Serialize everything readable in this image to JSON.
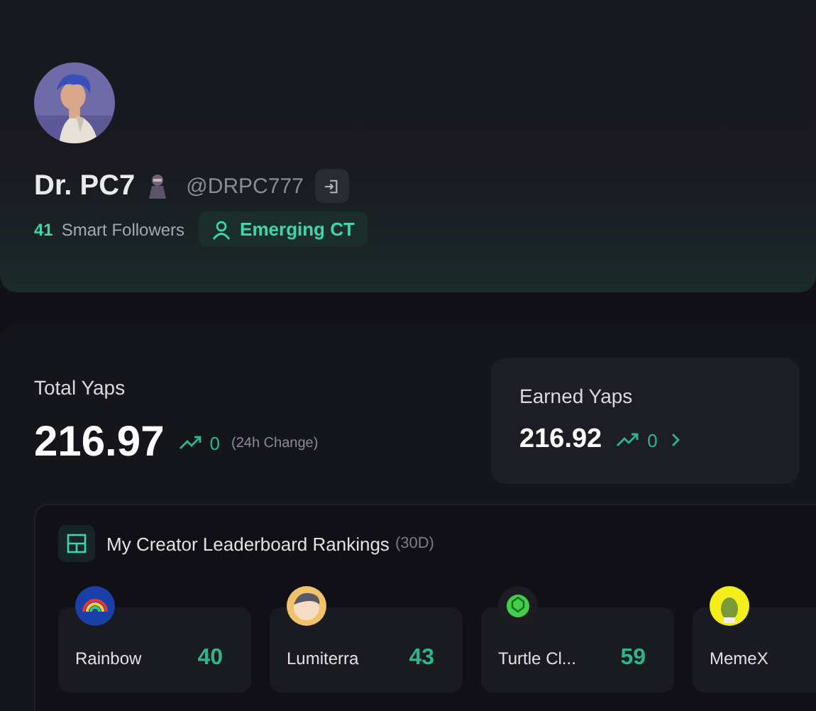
{
  "profile": {
    "name": "Dr. PC7",
    "handle": "@DRPC777",
    "smart_followers": {
      "count": "41",
      "label": "Smart Followers"
    },
    "tag": "Emerging CT"
  },
  "total": {
    "label": "Total Yaps",
    "value": "216.97",
    "change": "0",
    "note": "(24h Change)"
  },
  "earned": {
    "label": "Earned Yaps",
    "value": "216.92",
    "change": "0"
  },
  "leaderboard": {
    "title": "My Creator Leaderboard Rankings",
    "period": "(30D)",
    "items": [
      {
        "name": "Rainbow",
        "rank": "40",
        "kind": "rainbow"
      },
      {
        "name": "Lumiterra",
        "rank": "43",
        "kind": "character"
      },
      {
        "name": "Turtle Cl...",
        "rank": "59",
        "kind": "turtle"
      },
      {
        "name": "MemeX",
        "kind": "sprout"
      }
    ]
  }
}
